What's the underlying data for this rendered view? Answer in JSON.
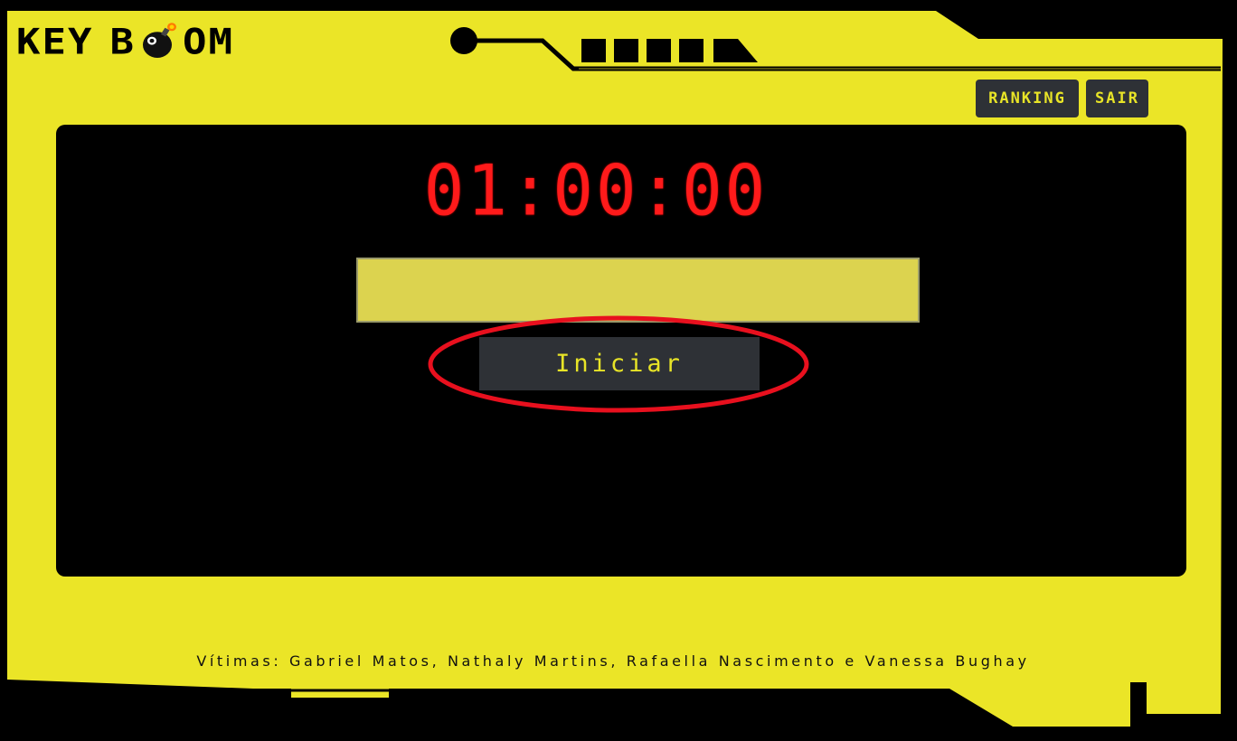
{
  "app": {
    "brand_word_1": "KEY",
    "brand_word_2_prefix": "B",
    "brand_word_2_suffix": "OM",
    "accent_color": "#ebe527",
    "timer_color": "#ff1a1a"
  },
  "nav": {
    "ranking_label": "Ranking",
    "exit_label": "Sair"
  },
  "game": {
    "timer": "01:00:00",
    "key_input_value": "",
    "key_input_placeholder": "",
    "start_label": "Iniciar"
  },
  "footer": {
    "credits": "Vítimas: Gabriel Matos, Nathaly Martins, Rafaella Nascimento e Vanessa Bughay"
  },
  "icons": [
    "bomb-icon",
    "circuit-decoration"
  ]
}
